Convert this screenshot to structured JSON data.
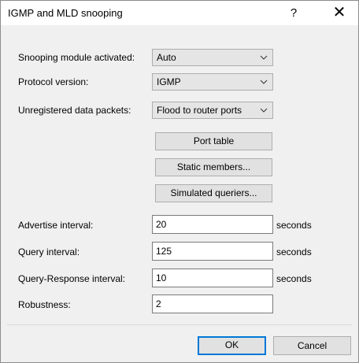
{
  "window": {
    "title": "IGMP and MLD snooping",
    "help_label": "?",
    "close_label": "✕"
  },
  "fields": {
    "snooping_module": {
      "label": "Snooping module activated:",
      "value": "Auto"
    },
    "protocol_version": {
      "label": "Protocol version:",
      "value": "IGMP"
    },
    "unregistered_packets": {
      "label": "Unregistered data packets:",
      "value": "Flood to router ports"
    },
    "advertise_interval": {
      "label": "Advertise interval:",
      "value": "20",
      "unit": "seconds"
    },
    "query_interval": {
      "label": "Query interval:",
      "value": "125",
      "unit": "seconds"
    },
    "query_response_interval": {
      "label": "Query-Response interval:",
      "value": "10",
      "unit": "seconds"
    },
    "robustness": {
      "label": "Robustness:",
      "value": "2"
    }
  },
  "buttons": {
    "port_table": "Port table",
    "static_members": "Static members...",
    "simulated_queriers": "Simulated queriers...",
    "ok": "OK",
    "cancel": "Cancel"
  },
  "icons": {
    "dropdown": "chevron-down-icon",
    "close": "close-icon",
    "help": "help-icon"
  }
}
